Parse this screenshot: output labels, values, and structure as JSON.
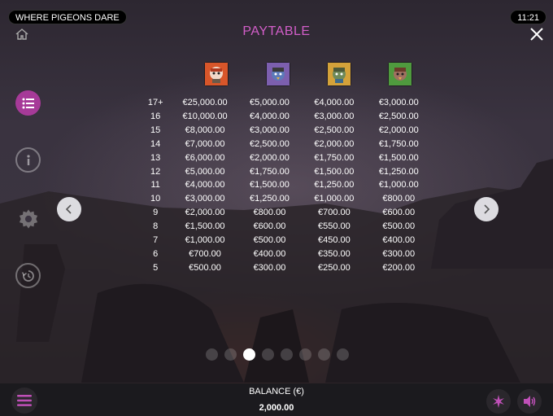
{
  "header": {
    "game_title": "WHERE PIGEONS DARE",
    "clock": "11:21",
    "page_title": "PAYTABLE"
  },
  "side_menu": [
    {
      "name": "paytable",
      "icon": "list-icon",
      "active": true
    },
    {
      "name": "info",
      "icon": "info-icon",
      "active": false
    },
    {
      "name": "settings",
      "icon": "gear-icon",
      "active": false
    },
    {
      "name": "history",
      "icon": "history-icon",
      "active": false
    }
  ],
  "symbols": [
    {
      "icon": "pigeon-red-symbol-icon",
      "color": "#d8562a"
    },
    {
      "icon": "pigeon-purple-symbol-icon",
      "color": "#7c5fae"
    },
    {
      "icon": "pigeon-yellow-symbol-icon",
      "color": "#d4a23a"
    },
    {
      "icon": "pigeon-green-symbol-icon",
      "color": "#4f9a3e"
    }
  ],
  "paytable": {
    "rows": [
      {
        "count": "17+",
        "values": [
          "€25,000.00",
          "€5,000.00",
          "€4,000.00",
          "€3,000.00"
        ]
      },
      {
        "count": "16",
        "values": [
          "€10,000.00",
          "€4,000.00",
          "€3,000.00",
          "€2,500.00"
        ]
      },
      {
        "count": "15",
        "values": [
          "€8,000.00",
          "€3,000.00",
          "€2,500.00",
          "€2,000.00"
        ]
      },
      {
        "count": "14",
        "values": [
          "€7,000.00",
          "€2,500.00",
          "€2,000.00",
          "€1,750.00"
        ]
      },
      {
        "count": "13",
        "values": [
          "€6,000.00",
          "€2,000.00",
          "€1,750.00",
          "€1,500.00"
        ]
      },
      {
        "count": "12",
        "values": [
          "€5,000.00",
          "€1,750.00",
          "€1,500.00",
          "€1,250.00"
        ]
      },
      {
        "count": "11",
        "values": [
          "€4,000.00",
          "€1,500.00",
          "€1,250.00",
          "€1,000.00"
        ]
      },
      {
        "count": "10",
        "values": [
          "€3,000.00",
          "€1,250.00",
          "€1,000.00",
          "€800.00"
        ]
      },
      {
        "count": "9",
        "values": [
          "€2,000.00",
          "€800.00",
          "€700.00",
          "€600.00"
        ]
      },
      {
        "count": "8",
        "values": [
          "€1,500.00",
          "€600.00",
          "€550.00",
          "€500.00"
        ]
      },
      {
        "count": "7",
        "values": [
          "€1,000.00",
          "€500.00",
          "€450.00",
          "€400.00"
        ]
      },
      {
        "count": "6",
        "values": [
          "€700.00",
          "€400.00",
          "€350.00",
          "€300.00"
        ]
      },
      {
        "count": "5",
        "values": [
          "€500.00",
          "€300.00",
          "€250.00",
          "€200.00"
        ]
      }
    ]
  },
  "pagination": {
    "total": 8,
    "current": 3
  },
  "footer": {
    "balance_label": "BALANCE (€)",
    "balance_value": "2,000.00"
  },
  "colors": {
    "accent": "#d25ec9",
    "active_button": "#a63a98",
    "bar": "#1b1a1e"
  }
}
